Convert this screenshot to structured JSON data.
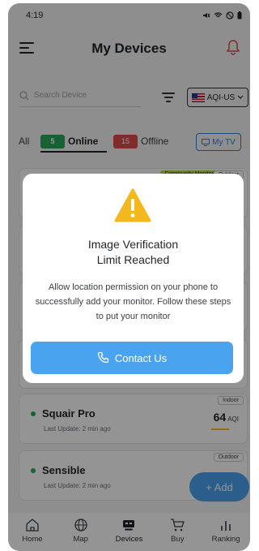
{
  "status_bar": {
    "time": "4:19"
  },
  "header": {
    "title": "My Devices"
  },
  "search": {
    "placeholder": "Search Device"
  },
  "aqi_selector": {
    "value": "AQI-US"
  },
  "tabs": {
    "all_label": "All",
    "online_count": "5",
    "online_label": "Online",
    "offline_count": "15",
    "offline_label": "Offline",
    "mytv_label": "My TV"
  },
  "devices": [
    {
      "tag": "Outdoor",
      "community_tag": "Community Monitor"
    },
    {
      "name": "Squair Pro",
      "update": "Last Update: 2 min ago",
      "aqi": "64",
      "aqi_unit": "AQI",
      "tag": "Indoor"
    },
    {
      "name": "Sensible",
      "update": "Last Update: 2 min ago",
      "aqi": "",
      "aqi_unit": "",
      "tag": "Outdoor"
    }
  ],
  "add_button": {
    "label": "+ Add"
  },
  "bottom_nav": [
    {
      "label": "Home",
      "icon": "home-icon"
    },
    {
      "label": "Map",
      "icon": "globe-icon"
    },
    {
      "label": "Devices",
      "icon": "devices-icon",
      "active": true
    },
    {
      "label": "Buy",
      "icon": "cart-icon"
    },
    {
      "label": "Ranking",
      "icon": "ranking-icon"
    }
  ],
  "modal": {
    "title_line1": "Image Verification",
    "title_line2": "Limit Reached",
    "body": "Allow location permission on your phone to successfully add your monitor. Follow these steps to put your monitor",
    "button_label": "Contact Us"
  },
  "colors": {
    "accent": "#4aa3ee",
    "online": "#26a95a",
    "offline": "#e04b4b",
    "warning": "#f2b81e"
  }
}
